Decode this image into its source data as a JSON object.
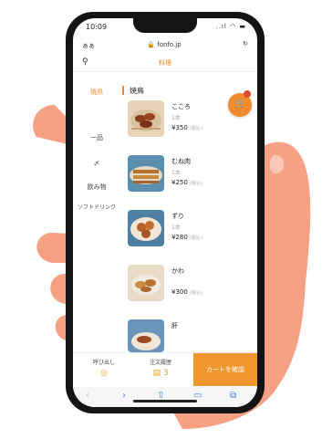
{
  "status": {
    "time": "10:09",
    "icons": "..ıl ◠ ▬"
  },
  "browser": {
    "aa": "ぁぁ",
    "url": "🔒 fonfo.jp",
    "reload": "↻"
  },
  "header": {
    "title": "料理"
  },
  "sidebar": {
    "items": [
      {
        "label": "焼鳥",
        "active": true
      },
      {
        "label": "一品"
      },
      {
        "label": "〆"
      },
      {
        "label": "飲み物"
      },
      {
        "label": "ソフトドリンク"
      }
    ]
  },
  "category_title": "焼鳥",
  "menu": {
    "items": [
      {
        "name": "こころ",
        "sub": "1本",
        "price": "¥350",
        "tax": "(税込)"
      },
      {
        "name": "むね肉",
        "sub": "1本",
        "price": "¥250",
        "tax": "(税込)"
      },
      {
        "name": "ずり",
        "sub": "1本",
        "price": "¥280",
        "tax": "(税込)"
      },
      {
        "name": "かわ",
        "sub": "",
        "price": "¥300",
        "tax": "(税込)"
      },
      {
        "name": "肝",
        "sub": "",
        "price": "",
        "tax": ""
      }
    ]
  },
  "bottom": {
    "call_label": "呼び出し",
    "call_icon": "◎",
    "history_label": "注文履歴",
    "history_count": "3",
    "cart_label": "カートを確認"
  },
  "toolbar": {
    "back": "‹",
    "forward": "›",
    "share": "⇧",
    "bookmarks": "▭",
    "tabs": "⧉"
  },
  "colors": {
    "accent": "#f08a2c",
    "skin": "#f6a184",
    "phone": "#141414"
  }
}
